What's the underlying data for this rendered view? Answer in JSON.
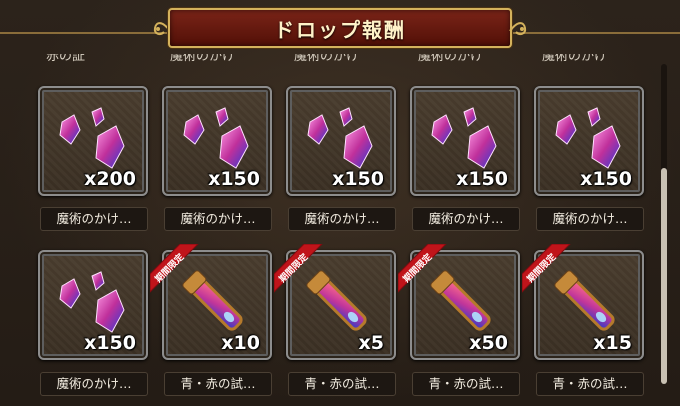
{
  "screen": {
    "title": "ドロップ報酬"
  },
  "partial_labels": [
    "赤の証",
    "魔術のかけ",
    "魔術のかけ",
    "魔術のかけ",
    "魔術のかけ"
  ],
  "rows": [
    [
      {
        "icon": "magic-crystal-shards-icon",
        "quantity": "x200",
        "name": "魔術のかけ…",
        "limited": false
      },
      {
        "icon": "magic-crystal-shards-icon",
        "quantity": "x150",
        "name": "魔術のかけ…",
        "limited": false
      },
      {
        "icon": "magic-crystal-shards-icon",
        "quantity": "x150",
        "name": "魔術のかけ…",
        "limited": false
      },
      {
        "icon": "magic-crystal-shards-icon",
        "quantity": "x150",
        "name": "魔術のかけ…",
        "limited": false
      },
      {
        "icon": "magic-crystal-shards-icon",
        "quantity": "x150",
        "name": "魔術のかけ…",
        "limited": false
      }
    ],
    [
      {
        "icon": "magic-crystal-shards-icon",
        "quantity": "x150",
        "name": "魔術のかけ…",
        "limited": false
      },
      {
        "icon": "test-vial-icon",
        "quantity": "x10",
        "name": "青・赤の試…",
        "limited": true,
        "badge": "期間限定"
      },
      {
        "icon": "test-vial-icon",
        "quantity": "x5",
        "name": "青・赤の試…",
        "limited": true,
        "badge": "期間限定"
      },
      {
        "icon": "test-vial-icon",
        "quantity": "x50",
        "name": "青・赤の試…",
        "limited": true,
        "badge": "期間限定"
      },
      {
        "icon": "test-vial-icon",
        "quantity": "x15",
        "name": "青・赤の試…",
        "limited": true,
        "badge": "期間限定"
      }
    ]
  ],
  "colors": {
    "title_plate": "#6b1c12",
    "title_border": "#d4b25c",
    "limited_ribbon": "#c0141a",
    "tile_frame": "#8d8d8d"
  }
}
